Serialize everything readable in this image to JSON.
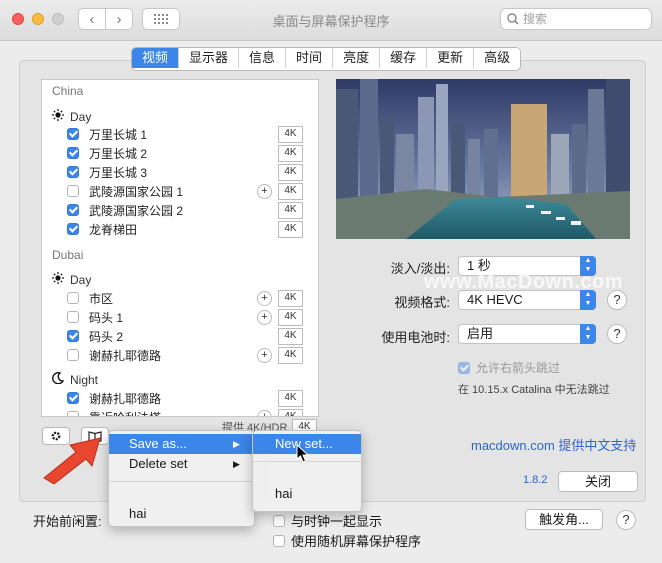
{
  "window": {
    "title": "桌面与屏幕保护程序",
    "search_placeholder": "搜索"
  },
  "tabs": [
    {
      "label": "视频",
      "active": true
    },
    {
      "label": "显示器"
    },
    {
      "label": "信息"
    },
    {
      "label": "时间"
    },
    {
      "label": "亮度"
    },
    {
      "label": "缓存"
    },
    {
      "label": "更新"
    },
    {
      "label": "高级"
    }
  ],
  "video_list": {
    "groups": [
      {
        "name": "China",
        "sub": "Day",
        "sub_icon": "sun-icon",
        "items": [
          {
            "label": "万里长城 1",
            "checked": true,
            "badge": "4K",
            "plus": false
          },
          {
            "label": "万里长城 2",
            "checked": true,
            "badge": "4K",
            "plus": false
          },
          {
            "label": "万里长城 3",
            "checked": true,
            "badge": "4K",
            "plus": false
          },
          {
            "label": "武陵源国家公园 1",
            "checked": false,
            "badge": "4K",
            "plus": true
          },
          {
            "label": "武陵源国家公园 2",
            "checked": true,
            "badge": "4K",
            "plus": false
          },
          {
            "label": "龙脊梯田",
            "checked": true,
            "badge": "4K",
            "plus": false
          }
        ]
      },
      {
        "name": "Dubai",
        "sub": "Day",
        "sub_icon": "sun-icon",
        "items": [
          {
            "label": "市区",
            "checked": false,
            "badge": "4K",
            "plus": true
          },
          {
            "label": "码头 1",
            "checked": false,
            "badge": "4K",
            "plus": true
          },
          {
            "label": "码头 2",
            "checked": true,
            "badge": "4K",
            "plus": false
          },
          {
            "label": "谢赫扎耶德路",
            "checked": false,
            "badge": "4K",
            "plus": true
          }
        ]
      },
      {
        "name": "",
        "sub": "Night",
        "sub_icon": "moon-icon",
        "items": [
          {
            "label": "谢赫扎耶德路",
            "checked": true,
            "badge": "4K",
            "plus": false
          },
          {
            "label": "靠近哈利法塔",
            "checked": false,
            "badge": "4K",
            "plus": true
          }
        ]
      }
    ],
    "provide_label": "提供 4K/HDR",
    "provide_badge": "4K"
  },
  "settings": {
    "fade_label": "淡入/淡出:",
    "fade_value": "1 秒",
    "format_label": "视频格式:",
    "format_value": "4K HEVC",
    "battery_label": "使用电池时:",
    "battery_value": "启用",
    "allow_skip_label": "允许右箭头跳过",
    "catalina_note": "在 10.15.x Catalina 中无法跳过",
    "help": "?"
  },
  "footer": {
    "support_link": "macdown.com 提供中文支持",
    "version": "1.8.2",
    "close_button": "关闭"
  },
  "context_menu": {
    "save_as": "Save as...",
    "delete_set": "Delete set",
    "hai": "hai",
    "arrow": "▶"
  },
  "submenu": {
    "new_set": "New set...",
    "hai": "hai"
  },
  "bottom": {
    "idle_label": "开始前闲置:",
    "show_clock": "与时钟一起显示",
    "random_saver": "使用随机屏幕保护程序",
    "hot_corners": "触发角...",
    "help": "?"
  },
  "watermark": "www.MacDown.com"
}
